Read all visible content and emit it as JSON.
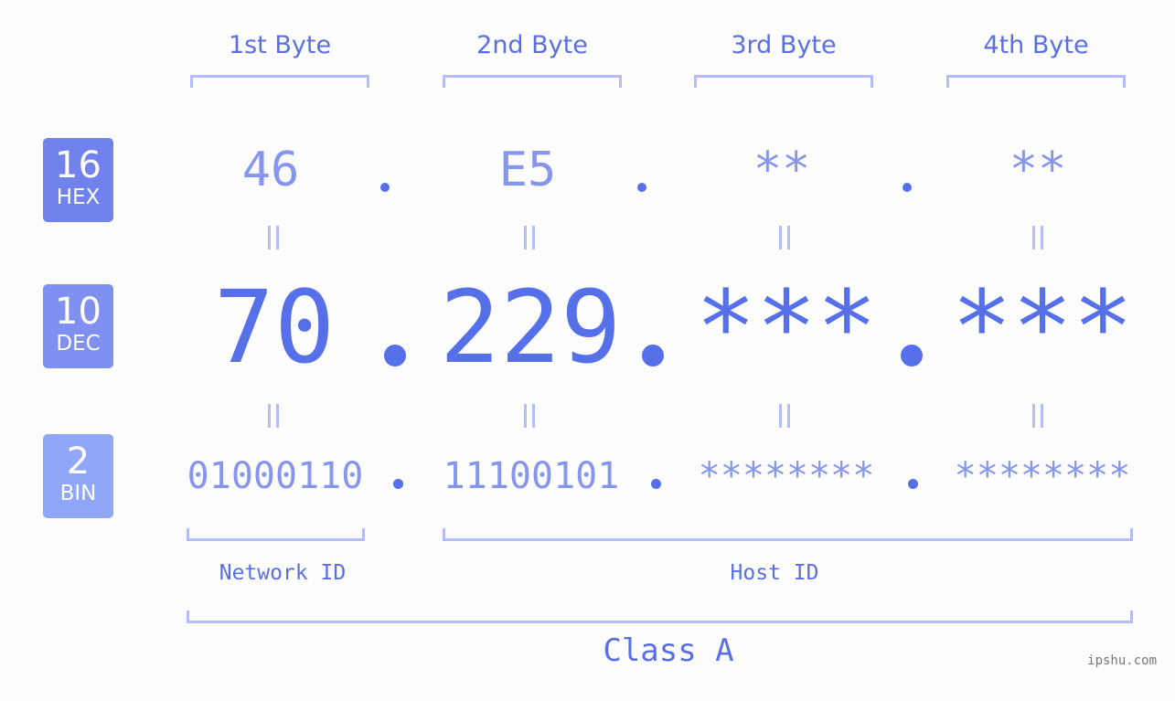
{
  "headers": [
    "1st Byte",
    "2nd Byte",
    "3rd Byte",
    "4th Byte"
  ],
  "badges": {
    "hex": {
      "number": "16",
      "label": "HEX",
      "color": "#7282ec"
    },
    "dec": {
      "number": "10",
      "label": "DEC",
      "color": "#8090f1"
    },
    "bin": {
      "number": "2",
      "label": "BIN",
      "color": "#8fa6f9"
    }
  },
  "hex": [
    "46",
    "E5",
    "**",
    "**"
  ],
  "dec": [
    "70",
    "229",
    "***",
    "***"
  ],
  "bin": [
    "01000110",
    "11100101",
    "********",
    "********"
  ],
  "separator": ".",
  "parts": {
    "network": "Network ID",
    "host": "Host ID",
    "class": "Class A"
  },
  "watermark": "ipshu.com",
  "colors": {
    "accent": "#5670ea",
    "light": "#8695ee",
    "bracket": "#b4bdf7",
    "background": "#fcfdfc"
  }
}
